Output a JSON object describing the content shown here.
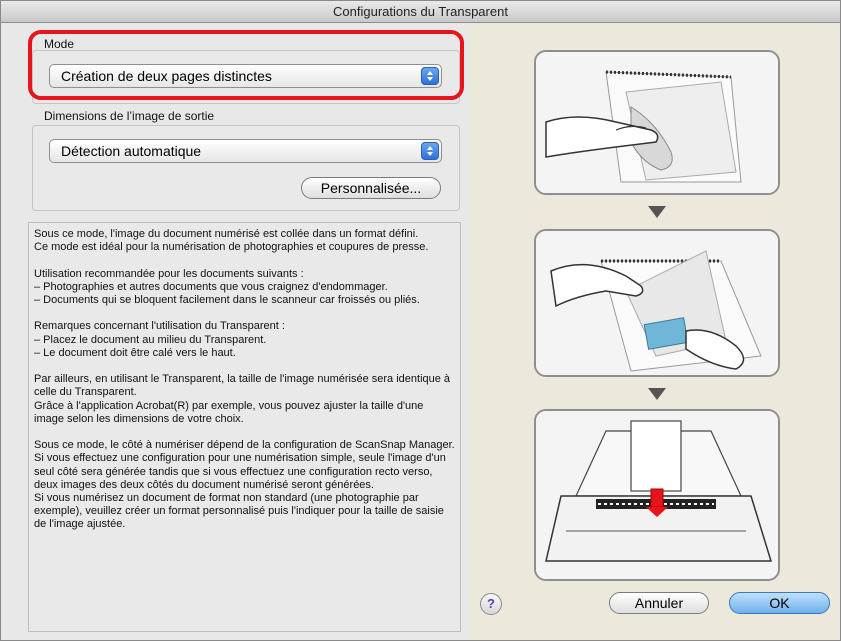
{
  "window": {
    "title": "Configurations du Transparent"
  },
  "mode": {
    "label": "Mode",
    "selected": "Création de deux pages distinctes"
  },
  "output_size": {
    "label": "Dimensions de l’image de sortie",
    "selected": "Détection automatique",
    "custom_button": "Personnalisée..."
  },
  "description": "Sous ce mode, l'image du document numérisé est collée dans un format défini.\nCe mode est idéal pour la numérisation de photographies et coupures de presse.\n\nUtilisation recommandée pour les documents suivants :\n– Photographies et autres documents que vous craignez d'endommager.\n– Documents qui se bloquent facilement dans le scanneur car froissés ou pliés.\n\nRemarques concernant l'utilisation du Transparent :\n– Placez le document au milieu du Transparent.\n– Le document doit être calé vers le haut.\n\nPar ailleurs, en utilisant le Transparent, la taille de l'image numérisée sera identique à celle du Transparent.\nGrâce à l'application Acrobat(R) par exemple, vous pouvez ajuster la taille d'une image selon les dimensions de votre choix.\n\nSous ce mode, le côté à numériser dépend de la configuration de ScanSnap Manager. Si vous effectuez une configuration pour une numérisation simple, seule l'image d'un seul côté sera générée tandis que si vous effectuez une configuration recto verso, deux images des deux côtés du document numérisé seront générées.\nSi vous numérisez un document de format non standard (une photographie par exemple), veuillez créer un format personnalisé puis l'indiquer pour la taille de saisie de l'image ajustée.",
  "buttons": {
    "help": "?",
    "cancel": "Annuler",
    "ok": "OK"
  }
}
